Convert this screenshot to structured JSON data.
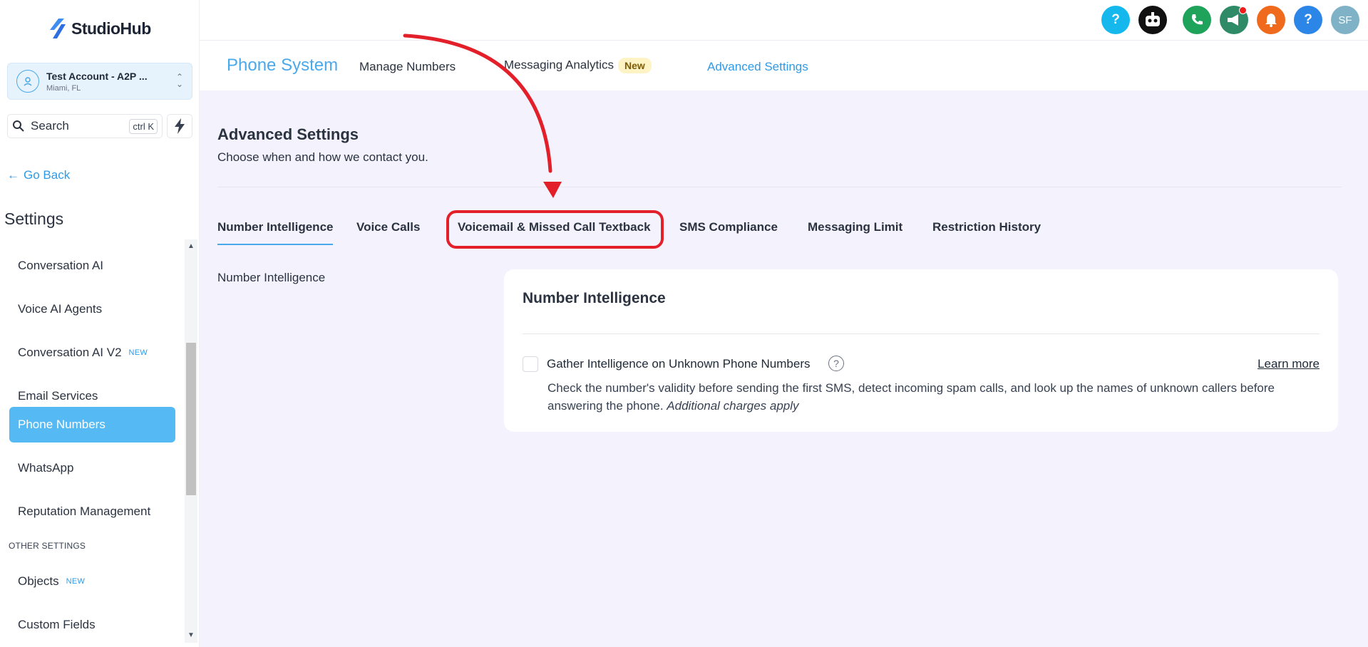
{
  "app": {
    "name": "StudioHub"
  },
  "account": {
    "name": "Test Account - A2P ...",
    "location": "Miami, FL"
  },
  "search": {
    "label": "Search",
    "shortcut": "ctrl K"
  },
  "nav": {
    "go_back": "Go Back",
    "settings_title": "Settings"
  },
  "sidebar": {
    "items": [
      {
        "label": "Conversation AI",
        "badge": ""
      },
      {
        "label": "Voice AI Agents",
        "badge": ""
      },
      {
        "label": "Conversation AI V2",
        "badge": "NEW"
      },
      {
        "label": "Email Services",
        "badge": ""
      },
      {
        "label": "Phone Numbers",
        "badge": "",
        "active": true
      },
      {
        "label": "WhatsApp",
        "badge": ""
      },
      {
        "label": "Reputation Management",
        "badge": ""
      }
    ],
    "section_other": "OTHER SETTINGS",
    "other_items": [
      {
        "label": "Objects",
        "badge": "NEW"
      },
      {
        "label": "Custom Fields",
        "badge": ""
      }
    ]
  },
  "topbar": {
    "icons": [
      {
        "name": "help-icon",
        "glyph": "?",
        "color": "#15b8ec"
      },
      {
        "name": "robot-icon",
        "glyph": "",
        "color": "#111111"
      },
      {
        "name": "phone-icon",
        "glyph": "",
        "color": "#1fa35a"
      },
      {
        "name": "megaphone-icon",
        "glyph": "",
        "color": "#2e8a67"
      },
      {
        "name": "bell-icon",
        "glyph": "",
        "color": "#f06a1e"
      },
      {
        "name": "question-icon",
        "glyph": "?",
        "color": "#2b86e8"
      },
      {
        "name": "avatar",
        "glyph": "SF",
        "color": "#7fb2c6"
      }
    ]
  },
  "subnav": {
    "title": "Phone System",
    "links": [
      "Manage Numbers",
      "Messaging Analytics",
      "Advanced Settings"
    ],
    "new_badge": "New"
  },
  "page": {
    "title": "Advanced Settings",
    "subtitle": "Choose when and how we contact you."
  },
  "tabs": [
    "Number Intelligence",
    "Voice Calls",
    "Voicemail & Missed Call Textback",
    "SMS Compliance",
    "Messaging Limit",
    "Restriction History"
  ],
  "section": {
    "left_label": "Number Intelligence",
    "card_title": "Number Intelligence",
    "option_title": "Gather Intelligence on Unknown Phone Numbers",
    "learn_more": "Learn more",
    "description": "Check the number's validity before sending the first SMS, detect incoming spam calls, and look up the names of unknown callers before answering the phone.",
    "charges_note": "Additional charges apply"
  },
  "colors": {
    "accent": "#4aa9ea",
    "active_menu": "#55b9f3",
    "annotation": "#e3202a",
    "main_bg": "#f3f2fd"
  }
}
